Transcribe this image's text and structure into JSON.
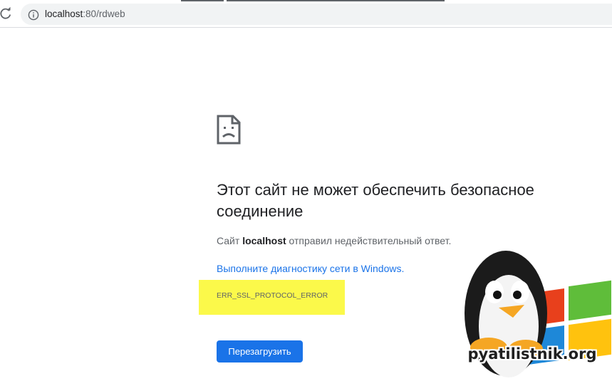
{
  "browser": {
    "url_host": "localhost",
    "url_path": ":80/rdweb"
  },
  "page": {
    "heading": "Этот сайт не может обеспечить безопасное соединение",
    "message_prefix": "Сайт ",
    "message_host": "localhost",
    "message_suffix": " отправил недействительный ответ.",
    "diagnostics_link": "Выполните диагностику сети в Windows.",
    "error_code": "ERR_SSL_PROTOCOL_ERROR",
    "reload_button": "Перезагрузить"
  },
  "watermark": {
    "text": "pyatilistnik.org"
  },
  "icons": {
    "reload": "reload-icon",
    "info": "info-icon",
    "error_page": "sad-page-icon",
    "watermark": "penguin-windows-logo"
  },
  "colors": {
    "link": "#1a73e8",
    "button": "#1a73e8",
    "highlight": "#fbf94a",
    "heading": "#202124",
    "body_text": "#5f6368"
  }
}
